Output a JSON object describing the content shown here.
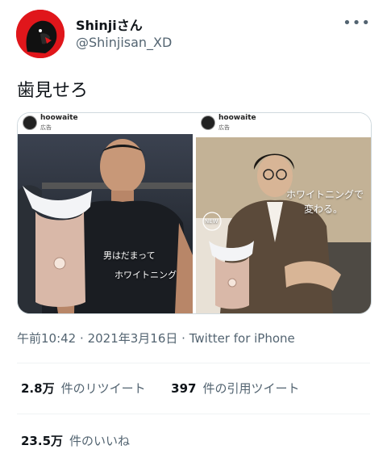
{
  "user": {
    "display_name": "Shinjiさん",
    "handle": "@Shinjisan_XD",
    "avatar_icon": "gorilla-avatar-icon"
  },
  "more_icon": "more-options-icon",
  "tweet": {
    "text": "歯見せろ"
  },
  "media": {
    "left": {
      "account": "hoowaite",
      "label": "広告",
      "caption_line1": "男はだまって",
      "caption_line2": "ホワイトニング"
    },
    "right": {
      "account": "hoowaite",
      "label": "広告",
      "caption_line1": "ホワイトニングで",
      "caption_line2": "変わる。",
      "badge": "NEW"
    }
  },
  "meta": {
    "time": "午前10:42",
    "date": "2021年3月16日",
    "source": "Twitter for iPhone"
  },
  "stats": {
    "retweets_value": "2.8万",
    "retweets_label": "件のリツイート",
    "quotes_value": "397",
    "quotes_label": "件の引用ツイート",
    "likes_value": "23.5万",
    "likes_label": "件のいいね"
  },
  "colors": {
    "accent": "#e0161b",
    "secondary_text": "#536471"
  }
}
